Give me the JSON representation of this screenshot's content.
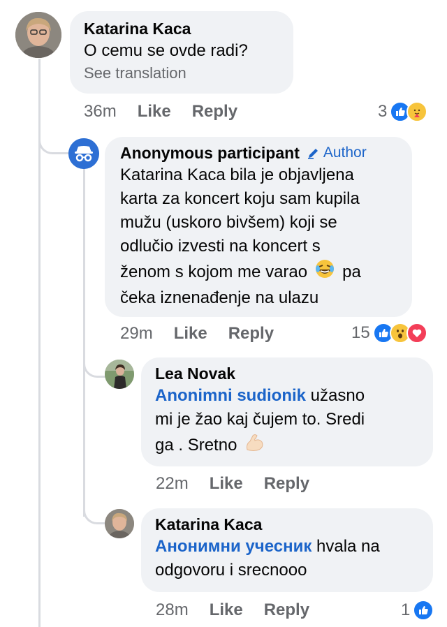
{
  "comments": [
    {
      "author": "Katarina Kaca",
      "text": "O cemu se ovde radi?",
      "translation_link": "See translation",
      "time": "36m",
      "like_label": "Like",
      "reply_label": "Reply",
      "reaction_count": "3",
      "reactions": [
        "like",
        "care"
      ]
    },
    {
      "author": "Anonymous participant",
      "badge": "Author",
      "lines": [
        "Katarina Kaca bila je objavljena",
        "karta za koncert koju sam kupila",
        "mužu (uskoro bivšem) koji se",
        "odlučio izvesti na koncert s",
        "ženom s kojom me varao",
        "pa",
        "čeka iznenađenje na ulazu"
      ],
      "time": "29m",
      "like_label": "Like",
      "reply_label": "Reply",
      "reaction_count": "15",
      "reactions": [
        "like",
        "wow",
        "love"
      ]
    },
    {
      "author": "Lea Novak",
      "mention": "Anonimni sudionik",
      "lines": [
        "užasno",
        "mi je žao kaj čujem to. Sredi",
        "ga . Sretno"
      ],
      "time": "22m",
      "like_label": "Like",
      "reply_label": "Reply"
    },
    {
      "author": "Katarina Kaca",
      "mention": "Анонимни учесник",
      "lines": [
        "hvala na",
        "odgovoru i srecnooo"
      ],
      "time": "28m",
      "like_label": "Like",
      "reply_label": "Reply",
      "reaction_count": "1",
      "reactions": [
        "like"
      ]
    }
  ],
  "colors": {
    "bubble": "#f0f2f5",
    "mention": "#1b64c9",
    "meta": "#65676b",
    "like": "#1877f2",
    "love": "#f33e58",
    "wow": "#f7c43c"
  }
}
